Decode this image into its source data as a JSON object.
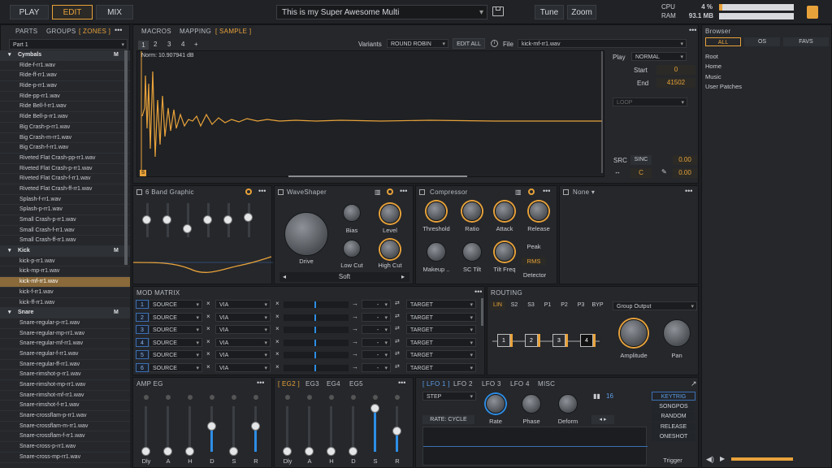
{
  "topbar": {
    "tabs": [
      "PLAY",
      "EDIT",
      "MIX"
    ],
    "active_tab": "EDIT",
    "multi_name": "This is my Super Awesome Multi",
    "tune": "Tune",
    "zoom": "Zoom",
    "cpu_label": "CPU",
    "cpu_value": "4 %",
    "ram_label": "RAM",
    "ram_value": "93.1 MB",
    "cpu_fraction": 0.04
  },
  "left": {
    "tabs": {
      "parts": "PARTS",
      "groups": "GROUPS",
      "zones": "[ ZONES ]"
    },
    "part_select": "Part 1",
    "items": [
      {
        "t": "Cymbals",
        "g": true,
        "m": "M"
      },
      {
        "t": "Ride-f-rr1.wav"
      },
      {
        "t": "Ride-ff-rr1.wav"
      },
      {
        "t": "Ride-p-rr1.wav"
      },
      {
        "t": "Ride-pp-rr1.wav"
      },
      {
        "t": "Ride Bell-f-rr1.wav"
      },
      {
        "t": "Ride Bell-p-rr1.wav"
      },
      {
        "t": "Big Crash-p-rr1.wav"
      },
      {
        "t": "Big Crash-m-rr1.wav"
      },
      {
        "t": "Big Crash-f-rr1.wav"
      },
      {
        "t": "Riveted Flat Crash-pp-rr1.wav"
      },
      {
        "t": "Riveted Flat Crash-p-rr1.wav"
      },
      {
        "t": "Riveted Flat Crash-f-rr1.wav"
      },
      {
        "t": "Riveted Flat Crash-ff-rr1.wav"
      },
      {
        "t": "Splash-f-rr1.wav"
      },
      {
        "t": "Splash-p-rr1.wav"
      },
      {
        "t": "Small Crash-p-rr1.wav"
      },
      {
        "t": "Small Crash-f-rr1.wav"
      },
      {
        "t": "Small Crash-ff-rr1.wav"
      },
      {
        "t": "Kick",
        "g": true,
        "m": "M"
      },
      {
        "t": "kick-p-rr1.wav"
      },
      {
        "t": "kick-mp-rr1.wav"
      },
      {
        "t": "kick-mf-rr1.wav",
        "sel": true
      },
      {
        "t": "kick-f-rr1.wav"
      },
      {
        "t": "kick-ff-rr1.wav"
      },
      {
        "t": "Snare",
        "g": true,
        "m": "M"
      },
      {
        "t": "Snare-regular-p-rr1.wav"
      },
      {
        "t": "Snare-regular-mp-rr1.wav"
      },
      {
        "t": "Snare-regular-mf-rr1.wav"
      },
      {
        "t": "Snare-regular-f-rr1.wav"
      },
      {
        "t": "Snare-regular-ff-rr1.wav"
      },
      {
        "t": "Snare-rimshot-p-rr1.wav"
      },
      {
        "t": "Snare-rimshot-mp-rr1.wav"
      },
      {
        "t": "Snare-rimshot-mf-rr1.wav"
      },
      {
        "t": "Snare-rimshot-f-rr1.wav"
      },
      {
        "t": "Snare-crossflam-p-rr1.wav"
      },
      {
        "t": "Snare-crossflam-m-rr1.wav"
      },
      {
        "t": "Snare-crossflam-f-rr1.wav"
      },
      {
        "t": "Snare-cross-p-rr1.wav"
      },
      {
        "t": "Snare-cross-mp-rr1.wav"
      }
    ]
  },
  "sample": {
    "tabs": {
      "macros": "MACROS",
      "mapping": "MAPPING",
      "sample": "[ SAMPLE ]"
    },
    "pages": [
      "1",
      "2",
      "3",
      "4",
      "+"
    ],
    "variants_label": "Variants",
    "variants_value": "ROUND ROBIN",
    "edit_all": "EDIT ALL",
    "file_label": "File",
    "file_value": "kick-mf-rr1.wav",
    "norm": "Norm: 10.907941 dB",
    "marker": "S"
  },
  "play": {
    "label": "Play",
    "mode": "NORMAL",
    "start_label": "Start",
    "start": "0",
    "end_label": "End",
    "end": "41502",
    "loop": "LOOP",
    "src_label": "SRC",
    "src_value": "SINC",
    "val1": "0.00",
    "c_value": "C",
    "val2": "0.00"
  },
  "browser": {
    "title": "Browser",
    "tabs": [
      "ALL",
      "OS",
      "FAVS"
    ],
    "items": [
      "Root",
      "Home",
      "Music",
      "User Patches"
    ]
  },
  "fx": {
    "eq": "6 Band Graphic",
    "waveshaper": "WaveShaper",
    "ws_knobs": {
      "drive": "Drive",
      "bias": "Bias",
      "level": "Level",
      "lowcut": "Low Cut",
      "highcut": "High Cut"
    },
    "ws_mode": "Soft",
    "comp": "Compressor",
    "comp_knobs": [
      "Threshold",
      "Ratio",
      "Attack",
      "Release",
      "Makeup ..",
      "SC Tilt",
      "Tilt Freq"
    ],
    "comp_peak": "Peak",
    "comp_rms": "RMS",
    "comp_detector": "Detector",
    "slot4": "None"
  },
  "modmatrix": {
    "title": "MOD MATRIX",
    "rows": [
      "1",
      "2",
      "3",
      "4",
      "5",
      "6"
    ],
    "source": "SOURCE",
    "via": "VIA",
    "dash": "-",
    "target": "TARGET"
  },
  "routing": {
    "title": "ROUTING",
    "tabs": [
      "LIN",
      "S2",
      "S3",
      "P1",
      "P2",
      "P3",
      "BYP"
    ],
    "output": "Group Output",
    "nodes": [
      "1",
      "2",
      "3",
      "4"
    ],
    "amplitude": "Amplitude",
    "pan": "Pan"
  },
  "ampeg": {
    "title": "AMP EG",
    "labels": [
      "Dly",
      "A",
      "H",
      "D",
      "S",
      "R"
    ],
    "levels": [
      0,
      0,
      0,
      0.55,
      0,
      0.55
    ]
  },
  "eg2": {
    "tabs": [
      "[ EG2 ]",
      "EG3",
      "EG4",
      "EG5"
    ],
    "labels": [
      "Dly",
      "A",
      "H",
      "D",
      "S",
      "R"
    ],
    "levels": [
      0,
      0,
      0,
      0,
      0.95,
      0.45
    ]
  },
  "lfo": {
    "tabs": [
      "[ LFO 1 ]",
      "LFO 2",
      "LFO 3",
      "LFO 4",
      "MISC"
    ],
    "mode": "STEP",
    "steps": "16",
    "rate_cycle": "RATE: CYCLE",
    "knobs": [
      "Rate",
      "Phase",
      "Deform"
    ],
    "triggers": [
      "KEYTRIG",
      "SONGPOS",
      "RANDOM",
      "RELEASE",
      "ONESHOT"
    ],
    "trigger_label": "Trigger"
  }
}
